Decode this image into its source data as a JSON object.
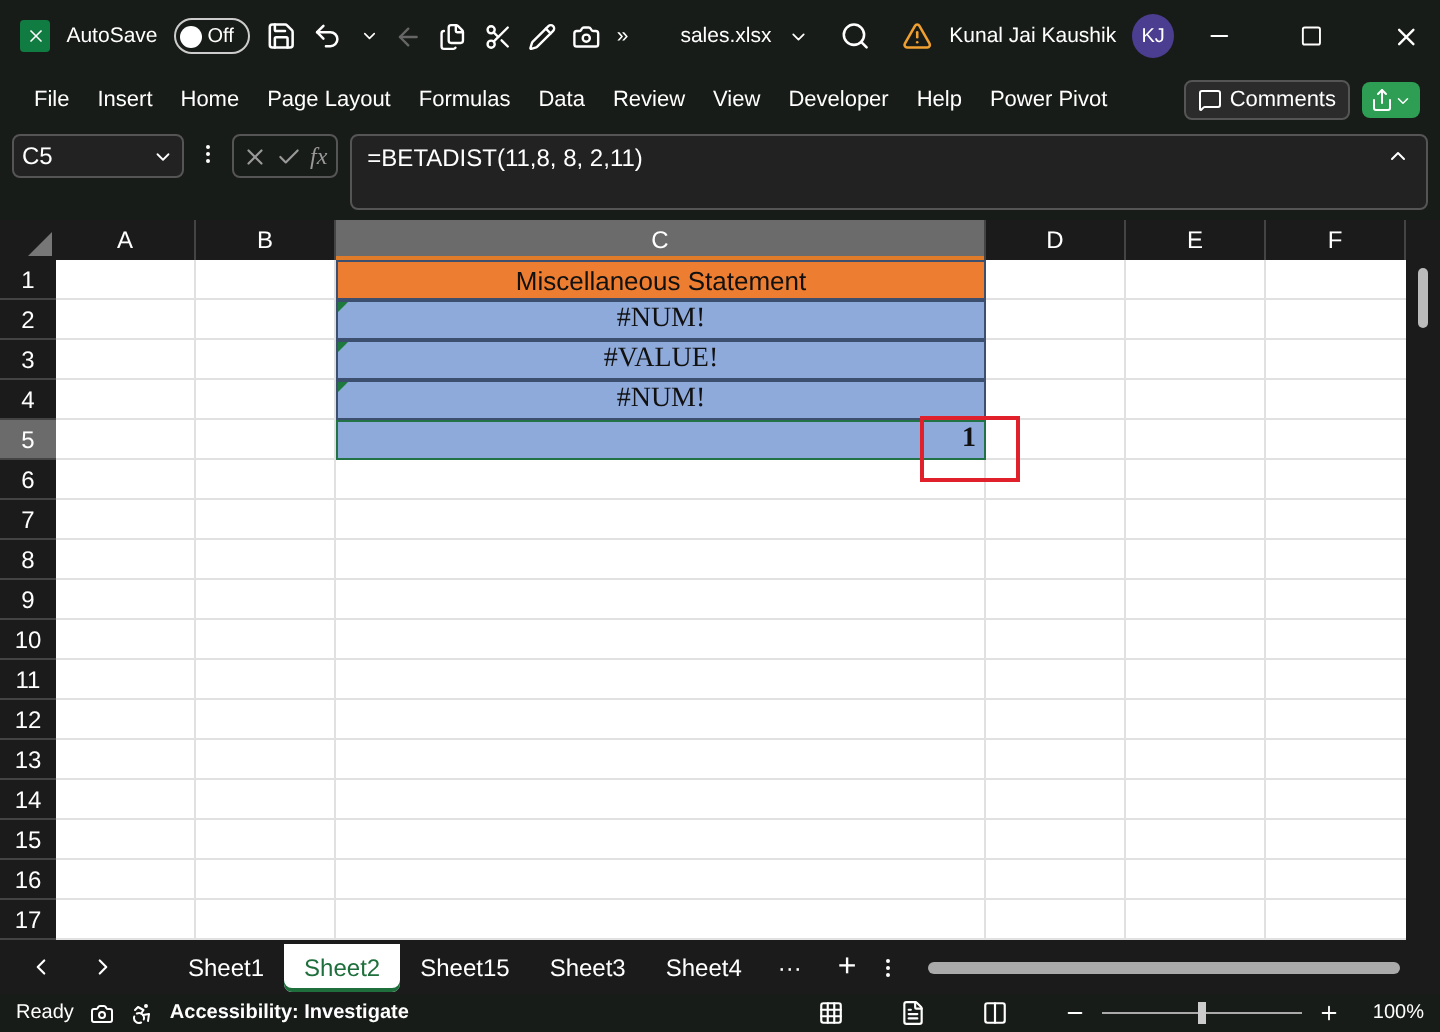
{
  "title_bar": {
    "autosave_label": "AutoSave",
    "autosave_on": false,
    "autosave_state": "Off",
    "more": "»",
    "file_name": "sales.xlsx",
    "user_name": "Kunal Jai Kaushik",
    "user_initials": "KJ"
  },
  "ribbon_tabs": [
    {
      "label": "File"
    },
    {
      "label": "Insert"
    },
    {
      "label": "Home"
    },
    {
      "label": "Page Layout"
    },
    {
      "label": "Formulas"
    },
    {
      "label": "Data"
    },
    {
      "label": "Review"
    },
    {
      "label": "View"
    },
    {
      "label": "Developer"
    },
    {
      "label": "Help"
    },
    {
      "label": "Power Pivot"
    }
  ],
  "comments_button": "Comments",
  "formula_bar": {
    "name_box": "C5",
    "fx": "fx",
    "formula": "=BETADIST(11,8, 8, 2,11)"
  },
  "columns": [
    {
      "label": "A",
      "selected": false
    },
    {
      "label": "B",
      "selected": false
    },
    {
      "label": "C",
      "selected": true
    },
    {
      "label": "D",
      "selected": false
    },
    {
      "label": "E",
      "selected": false
    },
    {
      "label": "F",
      "selected": false
    }
  ],
  "rows": [
    {
      "label": "1",
      "selected": false,
      "cell": {
        "kind": "header",
        "value": "Miscellaneous Statement"
      }
    },
    {
      "label": "2",
      "selected": false,
      "cell": {
        "kind": "error",
        "value": "#NUM!",
        "error_flag": true
      }
    },
    {
      "label": "3",
      "selected": false,
      "cell": {
        "kind": "error",
        "value": "#VALUE!",
        "error_flag": true
      }
    },
    {
      "label": "4",
      "selected": false,
      "cell": {
        "kind": "error",
        "value": "#NUM!",
        "error_flag": true
      }
    },
    {
      "label": "5",
      "selected": true,
      "cell": {
        "kind": "number",
        "value": "1",
        "highlighted": true
      }
    },
    {
      "label": "6",
      "selected": false
    },
    {
      "label": "7",
      "selected": false
    },
    {
      "label": "8",
      "selected": false
    },
    {
      "label": "9",
      "selected": false
    },
    {
      "label": "10",
      "selected": false
    },
    {
      "label": "11",
      "selected": false
    },
    {
      "label": "12",
      "selected": false
    },
    {
      "label": "13",
      "selected": false
    },
    {
      "label": "14",
      "selected": false
    },
    {
      "label": "15",
      "selected": false
    },
    {
      "label": "16",
      "selected": false
    },
    {
      "label": "17",
      "selected": false
    }
  ],
  "sheet_tabs": [
    {
      "label": "Sheet1",
      "selected": false
    },
    {
      "label": "Sheet2",
      "selected": true
    },
    {
      "label": "Sheet15",
      "selected": false
    },
    {
      "label": "Sheet3",
      "selected": false
    },
    {
      "label": "Sheet4",
      "selected": false
    }
  ],
  "sheet_more": "···",
  "sheet_add": "+",
  "status_bar": {
    "state": "Ready",
    "accessibility": "Accessibility: Investigate",
    "zoom": "100%",
    "zoom_slider": {
      "level": 0.5
    }
  }
}
